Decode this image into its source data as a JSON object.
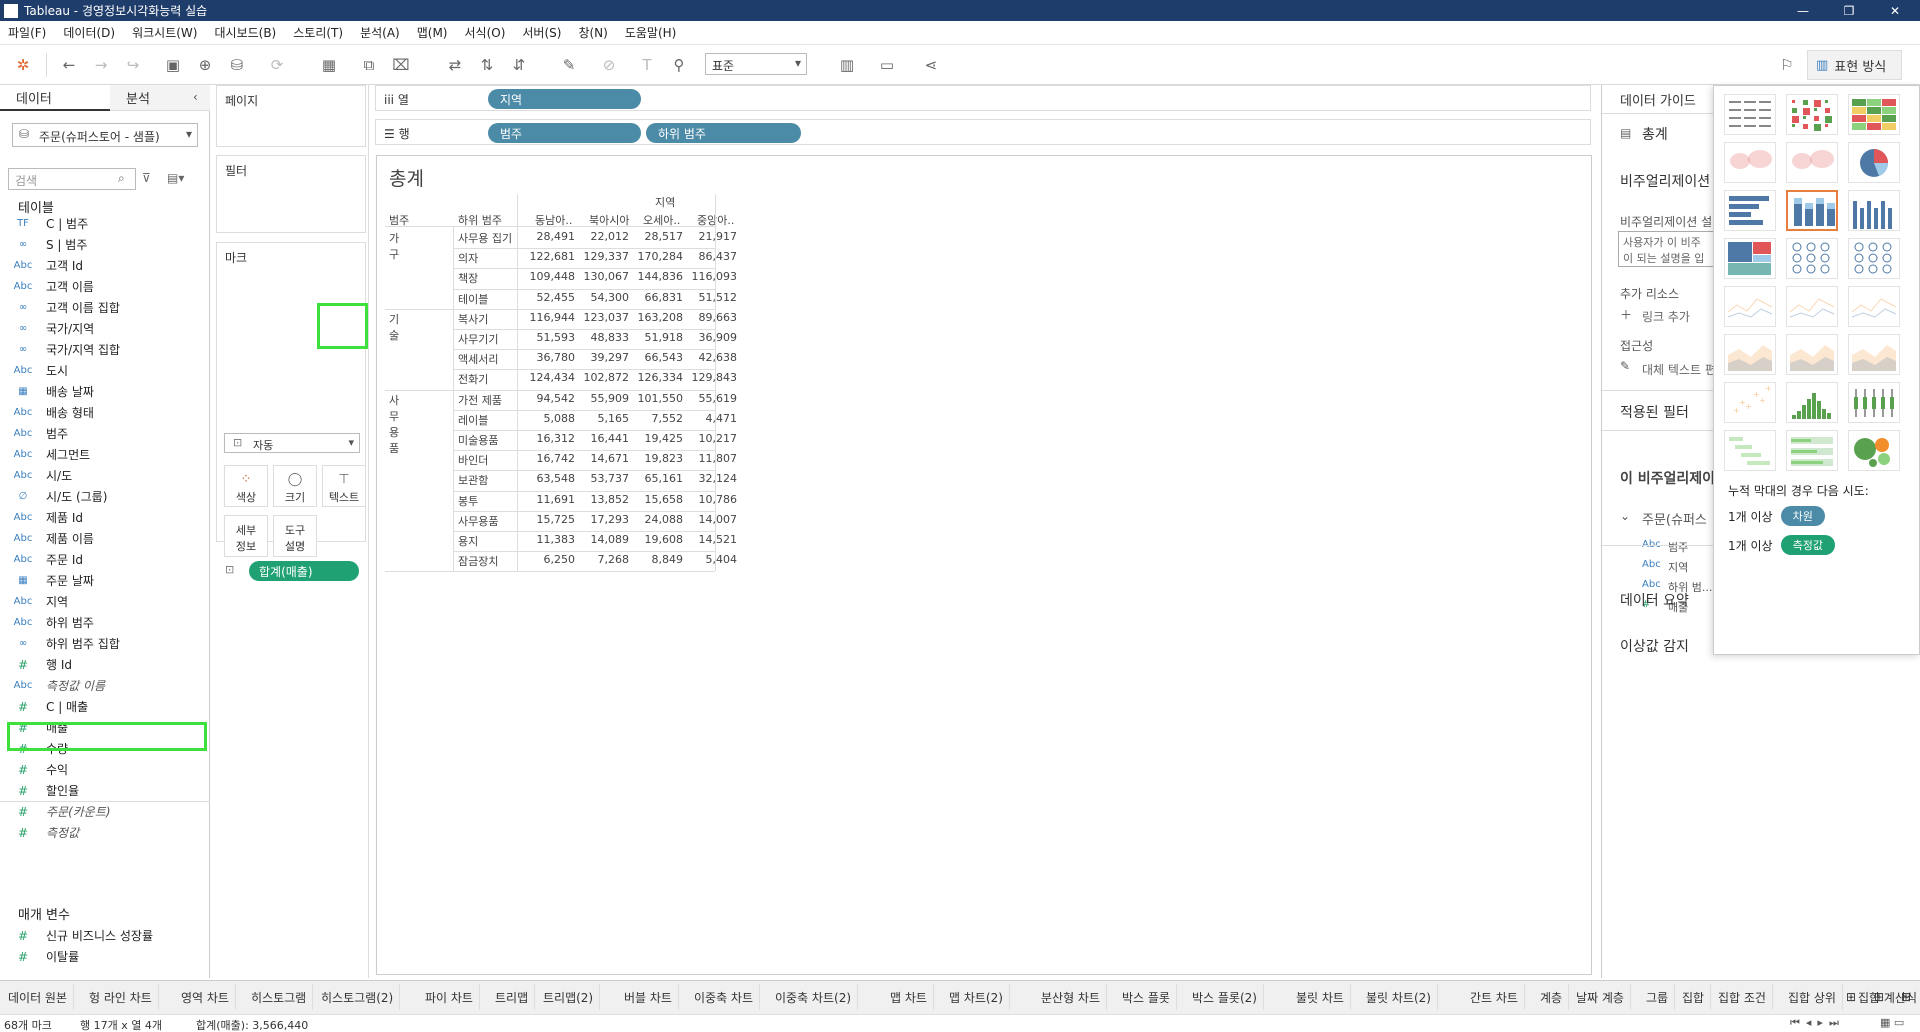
{
  "window": {
    "title": "Tableau - 경영정보시각화능력 실습"
  },
  "menu": [
    "파일(F)",
    "데이터(D)",
    "워크시트(W)",
    "대시보드(B)",
    "스토리(T)",
    "분석(A)",
    "맵(M)",
    "서식(O)",
    "서버(S)",
    "창(N)",
    "도움말(H)"
  ],
  "toolbar": {
    "fit": "표준",
    "showme_label": "표현 방식"
  },
  "data_pane": {
    "tab_data": "데이터",
    "tab_analysis": "분석",
    "datasource": "주문(슈퍼스토어 - 샘플)",
    "search_placeholder": "검색",
    "tables_header": "테이블",
    "fields": [
      {
        "icon": "TF",
        "name": "C | 범주"
      },
      {
        "icon": "∞",
        "name": "S | 범주"
      },
      {
        "icon": "Abc",
        "name": "고객 Id"
      },
      {
        "icon": "Abc",
        "name": "고객 이름"
      },
      {
        "icon": "∞",
        "name": "고객 이름 집합"
      },
      {
        "icon": "∞",
        "name": "국가/지역"
      },
      {
        "icon": "∞",
        "name": "국가/지역 집합"
      },
      {
        "icon": "Abc",
        "name": "도시"
      },
      {
        "icon": "▦",
        "name": "배송 날짜"
      },
      {
        "icon": "Abc",
        "name": "배송 형태"
      },
      {
        "icon": "Abc",
        "name": "범주"
      },
      {
        "icon": "Abc",
        "name": "세그먼트"
      },
      {
        "icon": "Abc",
        "name": "시/도"
      },
      {
        "icon": "∅",
        "name": "시/도 (그룹)"
      },
      {
        "icon": "Abc",
        "name": "제품 Id"
      },
      {
        "icon": "Abc",
        "name": "제품 이름"
      },
      {
        "icon": "Abc",
        "name": "주문 Id"
      },
      {
        "icon": "▦",
        "name": "주문 날짜"
      },
      {
        "icon": "Abc",
        "name": "지역"
      },
      {
        "icon": "Abc",
        "name": "하위 범주"
      },
      {
        "icon": "∞",
        "name": "하위 범주 집합"
      },
      {
        "icon": "#",
        "name": "행 Id"
      },
      {
        "icon": "Abc",
        "name": "측정값 이름",
        "italic": true
      },
      {
        "icon": "#",
        "name": "C | 매출"
      },
      {
        "icon": "#",
        "name": "매출"
      },
      {
        "icon": "#",
        "name": "수량"
      },
      {
        "icon": "#",
        "name": "수익"
      },
      {
        "icon": "#",
        "name": "할인율"
      },
      {
        "icon": "#",
        "name": "주문(카운트)",
        "italic": true
      },
      {
        "icon": "#",
        "name": "측정값",
        "italic": true
      }
    ],
    "params_header": "매개 변수",
    "params": [
      {
        "icon": "#",
        "name": "신규 비즈니스 성장률"
      },
      {
        "icon": "#",
        "name": "이탈률"
      }
    ]
  },
  "cards": {
    "pages": "페이지",
    "filters": "필터",
    "marks": "마크",
    "mark_type": "자동",
    "buttons": {
      "color": "색상",
      "size": "크기",
      "text": "텍스트",
      "detail": "세부\n정보",
      "tooltip": "도구\n설명"
    },
    "pill": "합계(매출)"
  },
  "shelves": {
    "columns_label": "열",
    "rows_label": "행",
    "columns": [
      "지역"
    ],
    "rows": [
      "범주",
      "하위 범주"
    ]
  },
  "view": {
    "title": "총계",
    "col_header_top": "지역",
    "row_headers": [
      "범주",
      "하위 범주"
    ],
    "columns": [
      "동남아..",
      "북아시아",
      "오세아..",
      "중앙아.."
    ],
    "groups": [
      {
        "category": "가구",
        "rows": [
          {
            "sub": "사무용 집기",
            "values": [
              "28,491",
              "22,012",
              "28,517",
              "21,917"
            ]
          },
          {
            "sub": "의자",
            "values": [
              "122,681",
              "129,337",
              "170,284",
              "86,437"
            ]
          },
          {
            "sub": "책장",
            "values": [
              "109,448",
              "130,067",
              "144,836",
              "116,093"
            ]
          },
          {
            "sub": "테이블",
            "values": [
              "52,455",
              "54,300",
              "66,831",
              "51,512"
            ]
          }
        ]
      },
      {
        "category": "기술",
        "rows": [
          {
            "sub": "복사기",
            "values": [
              "116,944",
              "123,037",
              "163,208",
              "89,663"
            ]
          },
          {
            "sub": "사무기기",
            "values": [
              "51,593",
              "48,833",
              "51,918",
              "36,909"
            ]
          },
          {
            "sub": "액세서리",
            "values": [
              "36,780",
              "39,297",
              "66,543",
              "42,638"
            ]
          },
          {
            "sub": "전화기",
            "values": [
              "124,434",
              "102,872",
              "126,334",
              "129,843"
            ]
          }
        ]
      },
      {
        "category": "사무용품",
        "rows": [
          {
            "sub": "가전 제품",
            "values": [
              "94,542",
              "55,909",
              "101,550",
              "55,619"
            ]
          },
          {
            "sub": "레이블",
            "values": [
              "5,088",
              "5,165",
              "7,552",
              "4,471"
            ]
          },
          {
            "sub": "미술용품",
            "values": [
              "16,312",
              "16,441",
              "19,425",
              "10,217"
            ]
          },
          {
            "sub": "바인더",
            "values": [
              "16,742",
              "14,671",
              "19,823",
              "11,807"
            ]
          },
          {
            "sub": "보관함",
            "values": [
              "63,548",
              "53,737",
              "65,161",
              "32,124"
            ]
          },
          {
            "sub": "봉투",
            "values": [
              "11,691",
              "13,852",
              "15,658",
              "10,786"
            ]
          },
          {
            "sub": "사무용품",
            "values": [
              "15,725",
              "17,293",
              "24,088",
              "14,007"
            ]
          },
          {
            "sub": "용지",
            "values": [
              "11,383",
              "14,089",
              "19,608",
              "14,521"
            ]
          },
          {
            "sub": "잠금장치",
            "values": [
              "6,250",
              "7,268",
              "8,849",
              "5,404"
            ]
          }
        ]
      }
    ]
  },
  "right_pane": {
    "header": "데이터 가이드",
    "sheet_name": "총계",
    "viz_desc_header": "비주얼리제이션",
    "viz_desc_sub": "비주얼리제이션 설",
    "viz_desc_box": "사용자가 이 비주\n이 되는 설명을 입",
    "more_resources": "추가 리소스",
    "add_link": "링크 추가",
    "accessibility": "접근성",
    "alt_text": "대체 텍스트 편",
    "applied_filters": "적용된 필터",
    "this_viz": "이 비주얼리제이",
    "source": "주문(슈퍼스",
    "viz_fields": [
      {
        "icon": "Abc",
        "name": "범주"
      },
      {
        "icon": "Abc",
        "name": "지역"
      },
      {
        "icon": "Abc",
        "name": "하위 범..."
      },
      {
        "icon": "#",
        "name": "매출"
      }
    ],
    "data_summary": "데이터 요약",
    "outliers": "이상값 감지"
  },
  "show_me": {
    "hint": "누적 막대의 경우 다음 시도:",
    "req1_prefix": "1개 이상",
    "req1_pill": "차원",
    "req2_prefix": "1개 이상",
    "req2_pill": "측정값"
  },
  "sheet_tabs": [
    "데이터 원본",
    "헝 라인 차트",
    "영역 차트",
    "히스토그램",
    "히스토그램(2)",
    "파이 차트",
    "트리맵",
    "트리맵(2)",
    "버블 차트",
    "이중축 차트",
    "이중축 차트(2)",
    "맵 차트",
    "맵 차트(2)",
    "분산형 차트",
    "박스 플롯",
    "박스 플롯(2)",
    "불릿 차트",
    "불릿 차트(2)",
    "간트 차트",
    "계층",
    "날짜 계층",
    "그룹",
    "집합",
    "집합 조건",
    "집합 상위",
    "집합 계산식",
    "총계"
  ],
  "status": {
    "marks": "68개 마크",
    "rows_cols": "행 17개 x 열 4개",
    "sum": "합계(매출): 3,566,440"
  },
  "colors": {
    "accent_green": "#3de03d",
    "measure_pill": "#1fa174",
    "dim_pill": "#4c8ba7",
    "titlebar": "#1f3d6b"
  }
}
